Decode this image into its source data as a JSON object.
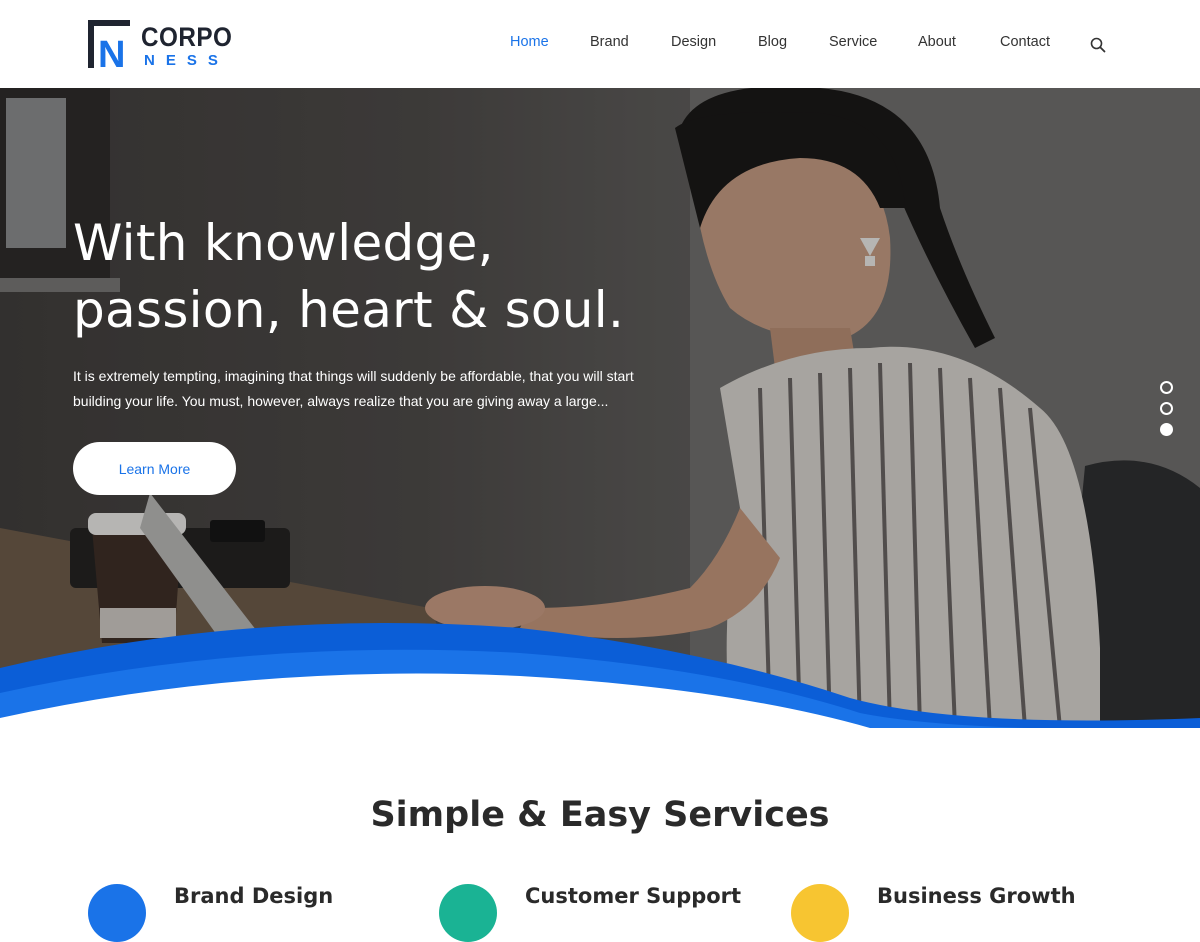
{
  "brand": {
    "logo_top": "CORPO",
    "logo_bottom": "NESS",
    "logo_letter": "N",
    "accent_color": "#1a73e8"
  },
  "nav": {
    "items": [
      {
        "label": "Home",
        "active": true
      },
      {
        "label": "Brand",
        "active": false
      },
      {
        "label": "Design",
        "active": false
      },
      {
        "label": "Blog",
        "active": false
      },
      {
        "label": "Service",
        "active": false
      },
      {
        "label": "About",
        "active": false
      },
      {
        "label": "Contact",
        "active": false
      }
    ],
    "search_icon": "search-icon"
  },
  "hero": {
    "title_line1": "With knowledge,",
    "title_line2": "passion, heart & soul.",
    "text_line1": "It is extremely tempting, imagining that things will suddenly be affordable, that you will start",
    "text_line2": "building your life. You must, however, always realize that you are giving away a large...",
    "button_label": "Learn More",
    "slides_count": 3,
    "active_slide": 3,
    "wave_colors": [
      "#0b5ed7",
      "#1a73e8"
    ]
  },
  "services": {
    "heading": "Simple & Easy Services",
    "items": [
      {
        "title": "Brand Design",
        "color": "#1a73e8"
      },
      {
        "title": "Customer Support",
        "color": "#1ab394"
      },
      {
        "title": "Business Growth",
        "color": "#f7c531"
      }
    ]
  }
}
